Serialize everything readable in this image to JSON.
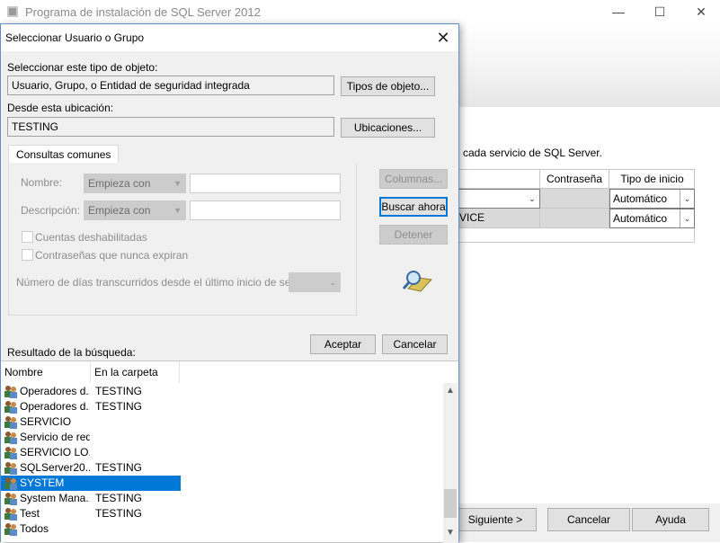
{
  "background_window": {
    "title": "Programa de instalación de SQL Server 2012",
    "window_buttons": {
      "minimize": "—",
      "maximize": "☐",
      "close": "✕"
    },
    "description": "cada servicio de SQL Server.",
    "grid": {
      "headers": [
        "Contraseña",
        "Tipo de inicio"
      ],
      "rows": [
        {
          "account": "",
          "startup": "Automático"
        },
        {
          "account": "VICE",
          "startup": "Automático"
        }
      ]
    },
    "buttons": {
      "next": "Siguiente >",
      "cancel": "Cancelar",
      "help": "Ayuda"
    }
  },
  "dialog": {
    "title": "Seleccionar Usuario o Grupo",
    "close_glyph": "✕",
    "object_type_label": "Seleccionar este tipo de objeto:",
    "object_type_value": "Usuario, Grupo, o Entidad de seguridad integrada",
    "object_types_button": "Tipos de objeto...",
    "location_label": "Desde esta ubicación:",
    "location_value": "TESTING",
    "locations_button": "Ubicaciones...",
    "tab_label": "Consultas comunes",
    "name_label": "Nombre:",
    "name_mode": "Empieza con",
    "description_label": "Descripción:",
    "description_mode": "Empieza con",
    "disabled_accounts_label": "Cuentas deshabilitadas",
    "non_expiring_label": "Contraseñas que nunca expiran",
    "days_label": "Número de días transcurridos desde el último inicio de sesión:",
    "columns_button": "Columnas...",
    "search_now_button": "Buscar ahora",
    "stop_button": "Detener",
    "accept_button": "Aceptar",
    "cancel_button": "Cancelar",
    "results_label": "Resultado de la búsqueda:",
    "results": {
      "columns": [
        "Nombre",
        "En la carpeta"
      ],
      "rows": [
        {
          "name": "Operadores d...",
          "folder": "TESTING"
        },
        {
          "name": "Operadores d...",
          "folder": "TESTING"
        },
        {
          "name": "SERVICIO",
          "folder": ""
        },
        {
          "name": "Servicio de red",
          "folder": ""
        },
        {
          "name": "SERVICIO LO...",
          "folder": ""
        },
        {
          "name": "SQLServer20...",
          "folder": "TESTING"
        },
        {
          "name": "SYSTEM",
          "folder": "",
          "selected": true
        },
        {
          "name": "System Mana...",
          "folder": "TESTING"
        },
        {
          "name": "Test",
          "folder": "TESTING"
        },
        {
          "name": "Todos",
          "folder": ""
        }
      ]
    },
    "scroll_up_glyph": "▲",
    "scroll_down_glyph": "▼"
  },
  "colors": {
    "accent": "#0078d7",
    "selection": "#0078d7",
    "dialog_bg": "#f0f0f0"
  }
}
